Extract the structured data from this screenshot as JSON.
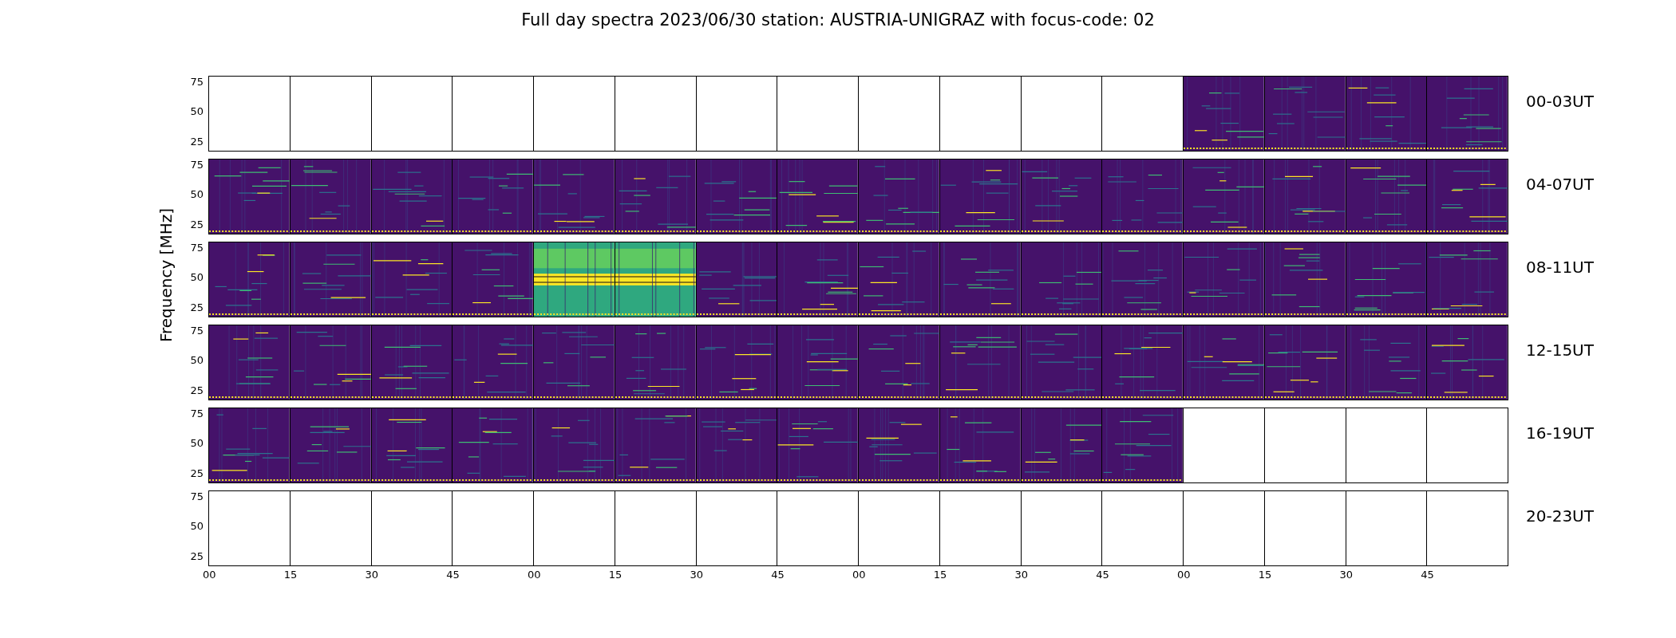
{
  "title": "Full day spectra 2023/06/30 station: AUSTRIA-UNIGRAZ with focus-code: 02",
  "ylabel": "Frequency [MHz]",
  "rows": [
    {
      "label": "00-03UT",
      "yticks": [
        "75",
        "50",
        "25"
      ],
      "panels": [
        {
          "kind": "empty"
        },
        {
          "kind": "empty"
        },
        {
          "kind": "empty"
        },
        {
          "kind": "empty"
        },
        {
          "kind": "empty"
        },
        {
          "kind": "empty"
        },
        {
          "kind": "empty"
        },
        {
          "kind": "empty"
        },
        {
          "kind": "empty"
        },
        {
          "kind": "empty"
        },
        {
          "kind": "empty"
        },
        {
          "kind": "empty"
        },
        {
          "kind": "spectrum"
        },
        {
          "kind": "spectrum"
        },
        {
          "kind": "spectrum"
        },
        {
          "kind": "spectrum"
        }
      ]
    },
    {
      "label": "04-07UT",
      "yticks": [
        "75",
        "50",
        "25"
      ],
      "panels": [
        {
          "kind": "spectrum"
        },
        {
          "kind": "spectrum"
        },
        {
          "kind": "spectrum"
        },
        {
          "kind": "spectrum"
        },
        {
          "kind": "spectrum"
        },
        {
          "kind": "spectrum"
        },
        {
          "kind": "spectrum"
        },
        {
          "kind": "spectrum"
        },
        {
          "kind": "spectrum"
        },
        {
          "kind": "spectrum"
        },
        {
          "kind": "spectrum"
        },
        {
          "kind": "spectrum"
        },
        {
          "kind": "spectrum"
        },
        {
          "kind": "spectrum"
        },
        {
          "kind": "spectrum"
        },
        {
          "kind": "spectrum"
        }
      ]
    },
    {
      "label": "08-11UT",
      "yticks": [
        "75",
        "50",
        "25"
      ],
      "panels": [
        {
          "kind": "spectrum"
        },
        {
          "kind": "spectrum"
        },
        {
          "kind": "spectrum"
        },
        {
          "kind": "spectrum"
        },
        {
          "kind": "burst"
        },
        {
          "kind": "burst"
        },
        {
          "kind": "spectrum"
        },
        {
          "kind": "spectrum"
        },
        {
          "kind": "spectrum"
        },
        {
          "kind": "spectrum"
        },
        {
          "kind": "spectrum"
        },
        {
          "kind": "spectrum"
        },
        {
          "kind": "spectrum"
        },
        {
          "kind": "spectrum"
        },
        {
          "kind": "spectrum"
        },
        {
          "kind": "spectrum"
        }
      ]
    },
    {
      "label": "12-15UT",
      "yticks": [
        "75",
        "50",
        "25"
      ],
      "panels": [
        {
          "kind": "spectrum"
        },
        {
          "kind": "spectrum"
        },
        {
          "kind": "spectrum"
        },
        {
          "kind": "spectrum"
        },
        {
          "kind": "spectrum"
        },
        {
          "kind": "spectrum"
        },
        {
          "kind": "spectrum"
        },
        {
          "kind": "spectrum"
        },
        {
          "kind": "spectrum"
        },
        {
          "kind": "spectrum"
        },
        {
          "kind": "spectrum"
        },
        {
          "kind": "spectrum"
        },
        {
          "kind": "spectrum"
        },
        {
          "kind": "spectrum"
        },
        {
          "kind": "spectrum"
        },
        {
          "kind": "spectrum"
        }
      ]
    },
    {
      "label": "16-19UT",
      "yticks": [
        "75",
        "50",
        "25"
      ],
      "panels": [
        {
          "kind": "spectrum"
        },
        {
          "kind": "spectrum"
        },
        {
          "kind": "spectrum"
        },
        {
          "kind": "spectrum"
        },
        {
          "kind": "spectrum"
        },
        {
          "kind": "spectrum"
        },
        {
          "kind": "spectrum"
        },
        {
          "kind": "spectrum"
        },
        {
          "kind": "spectrum"
        },
        {
          "kind": "spectrum"
        },
        {
          "kind": "spectrum"
        },
        {
          "kind": "spectrum"
        },
        {
          "kind": "empty"
        },
        {
          "kind": "empty"
        },
        {
          "kind": "empty"
        },
        {
          "kind": "empty"
        }
      ]
    },
    {
      "label": "20-23UT",
      "yticks": [
        "75",
        "50",
        "25"
      ],
      "panels": [
        {
          "kind": "empty"
        },
        {
          "kind": "empty"
        },
        {
          "kind": "empty"
        },
        {
          "kind": "empty"
        },
        {
          "kind": "empty"
        },
        {
          "kind": "empty"
        },
        {
          "kind": "empty"
        },
        {
          "kind": "empty"
        },
        {
          "kind": "empty"
        },
        {
          "kind": "empty"
        },
        {
          "kind": "empty"
        },
        {
          "kind": "empty"
        },
        {
          "kind": "empty"
        },
        {
          "kind": "empty"
        },
        {
          "kind": "empty"
        },
        {
          "kind": "empty"
        }
      ]
    }
  ],
  "xticks": [
    "00",
    "15",
    "30",
    "45",
    "00",
    "15",
    "30",
    "45",
    "00",
    "15",
    "30",
    "45",
    "00",
    "15",
    "30",
    "45"
  ]
}
